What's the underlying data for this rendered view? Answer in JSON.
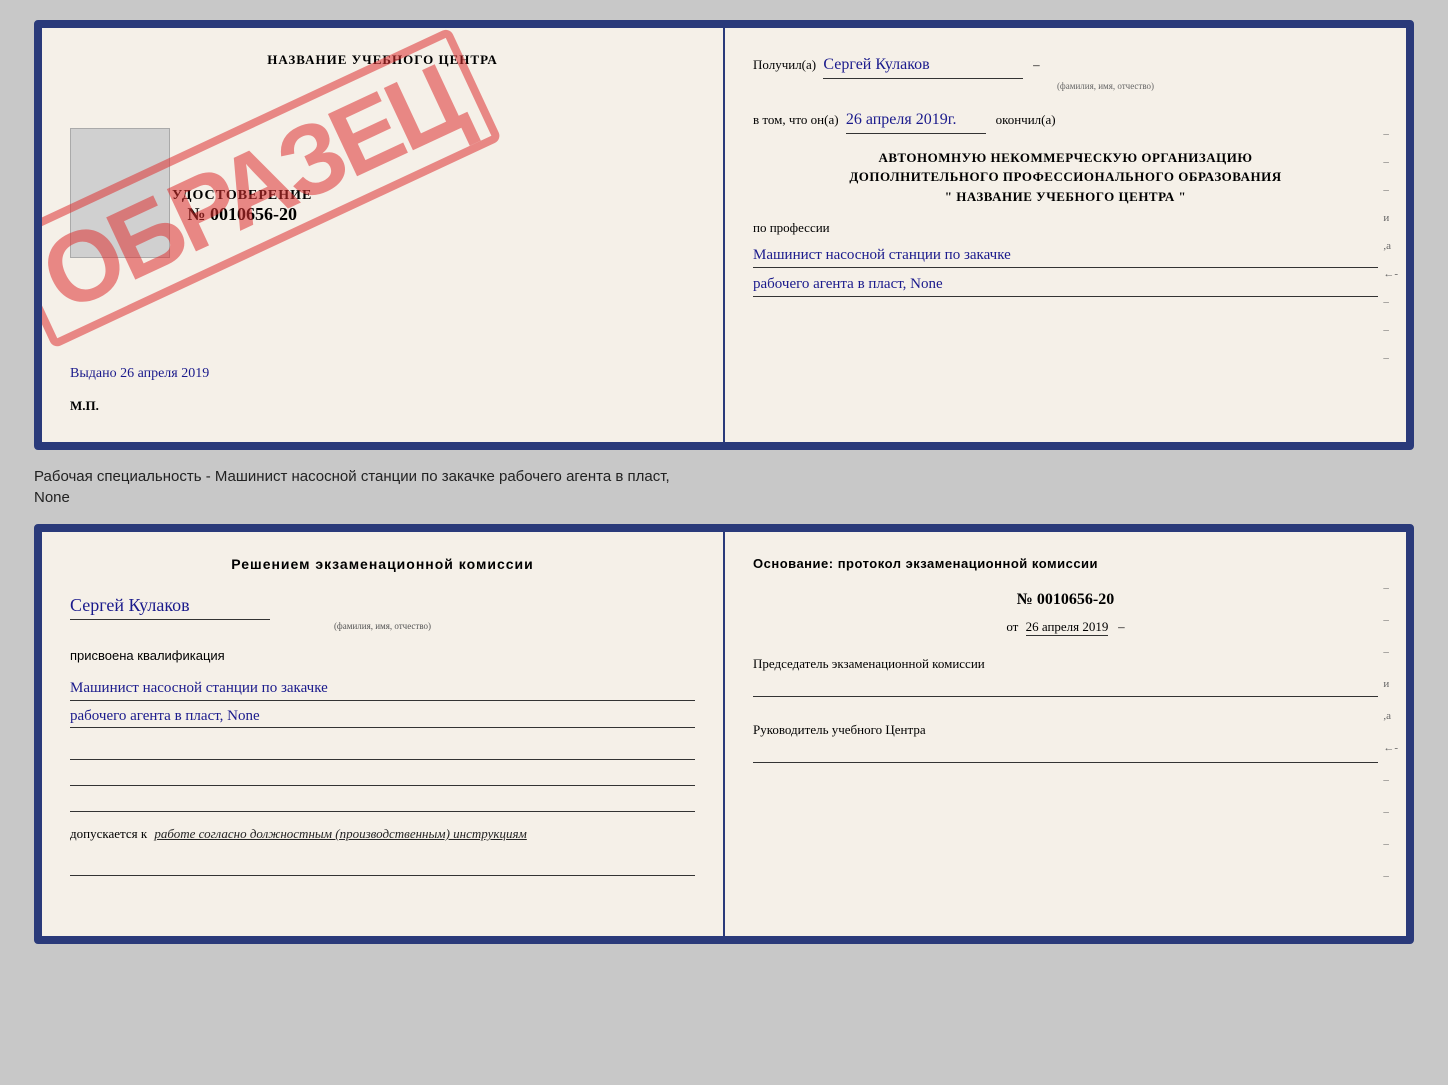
{
  "topDoc": {
    "left": {
      "title": "НАЗВАНИЕ УЧЕБНОГО ЦЕНТРА",
      "stamp": "ОБРАЗЕЦ",
      "udost": {
        "label": "УДОСТОВЕРЕНИЕ",
        "number": "№ 0010656-20"
      },
      "vydano": "Выдано 26 апреля 2019",
      "mp": "М.П."
    },
    "right": {
      "poluchil_prefix": "Получил(а)",
      "recipient": "Сергей Кулаков",
      "recipient_hint": "(фамилия, имя, отчество)",
      "vtom_prefix": "в том, что он(а)",
      "date": "26 апреля 2019г.",
      "okonchil": "окончил(а)",
      "org_line1": "АВТОНОМНУЮ НЕКОММЕРЧЕСКУЮ ОРГАНИЗАЦИЮ",
      "org_line2": "ДОПОЛНИТЕЛЬНОГО ПРОФЕССИОНАЛЬНОГО ОБРАЗОВАНИЯ",
      "org_line3": "\"  НАЗВАНИЕ УЧЕБНОГО ЦЕНТРА  \"",
      "po_professii": "по профессии",
      "profession_line1": "Машинист насосной станции по закачке",
      "profession_line2": "рабочего агента в пласт, None",
      "side_marks": [
        "-",
        "-",
        "-",
        "и",
        ",а",
        "←",
        "-",
        "-",
        "-"
      ]
    }
  },
  "descText": {
    "line1": "Рабочая специальность - Машинист насосной станции по закачке рабочего агента в пласт,",
    "line2": "None"
  },
  "bottomDoc": {
    "left": {
      "title": "Решением экзаменационной комиссии",
      "name": "Сергей Кулаков",
      "name_hint": "(фамилия, имя, отчество)",
      "prisvoena": "присвоена квалификация",
      "qual_line1": "Машинист насосной станции по закачке",
      "qual_line2": "рабочего агента в пласт, None",
      "dopuskaetsya": "допускается к",
      "work_text": "работе согласно должностным (производственным) инструкциям"
    },
    "right": {
      "osnov_title": "Основание: протокол экзаменационной комиссии",
      "protocol_num": "№ 0010656-20",
      "protocol_date_prefix": "от",
      "protocol_date": "26 апреля 2019",
      "predsedatel_label": "Председатель экзаменационной комиссии",
      "rukovoditel_label": "Руководитель учебного Центра",
      "side_marks": [
        "-",
        "-",
        "-",
        "и",
        ",а",
        "←",
        "-",
        "-",
        "-",
        "-"
      ]
    }
  }
}
